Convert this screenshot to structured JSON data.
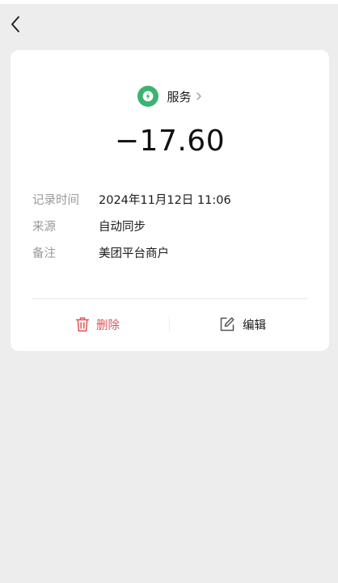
{
  "nav": {
    "back_icon": "chevron-left-icon"
  },
  "colors": {
    "page_background": "#ededed",
    "card_background": "#ffffff",
    "category_icon_bg": "#3cb371",
    "delete_red": "#e05555",
    "label_gray": "#9a9a9a",
    "text_primary": "#1a1a1a"
  },
  "category": {
    "icon": "lightning-icon",
    "label": "服务",
    "chevron": "chevron-right-icon"
  },
  "amount": "−17.60",
  "details": [
    {
      "key": "记录时间",
      "value": "2024年11月12日 11:06"
    },
    {
      "key": "来源",
      "value": "自动同步"
    },
    {
      "key": "备注",
      "value": "美团平台商户"
    }
  ],
  "actions": {
    "delete": {
      "icon": "trash-icon",
      "label": "删除"
    },
    "edit": {
      "icon": "edit-icon",
      "label": "编辑"
    }
  }
}
